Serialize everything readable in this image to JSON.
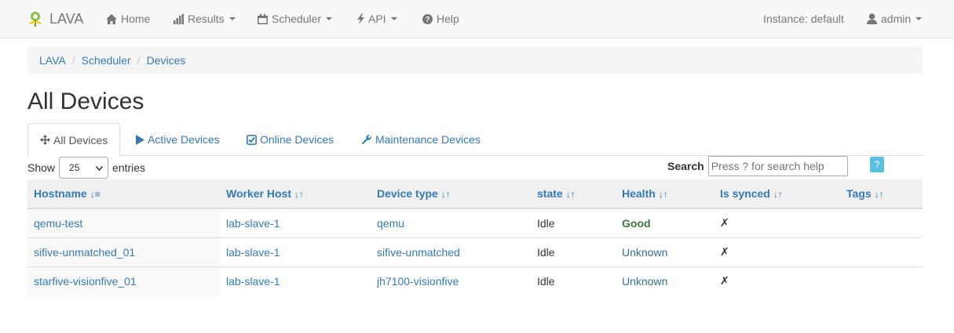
{
  "navbar": {
    "brand": "LAVA",
    "home": "Home",
    "results": "Results",
    "scheduler": "Scheduler",
    "api": "API",
    "help": "Help",
    "instance": "Instance: default",
    "user": "admin"
  },
  "breadcrumb": [
    "LAVA",
    "Scheduler",
    "Devices"
  ],
  "page_title": "All Devices",
  "tabs": [
    {
      "label": "All Devices",
      "icon": "move-icon"
    },
    {
      "label": "Active Devices",
      "icon": "play-icon"
    },
    {
      "label": "Online Devices",
      "icon": "check-square-icon"
    },
    {
      "label": "Maintenance Devices",
      "icon": "wrench-icon"
    }
  ],
  "controls": {
    "show_label": "Show",
    "entries_value": "25",
    "entries_label": "entries",
    "search_label": "Search",
    "search_placeholder": "Press ? for search help",
    "help_button": "?"
  },
  "table": {
    "columns": [
      "Hostname",
      "Worker Host",
      "Device type",
      "state",
      "Health",
      "Is synced",
      "Tags"
    ],
    "rows": [
      {
        "hostname": "qemu-test",
        "worker": "lab-slave-1",
        "device_type": "qemu",
        "state": "Idle",
        "health": "Good",
        "synced": "✗",
        "tags": ""
      },
      {
        "hostname": "sifive-unmatched_01",
        "worker": "lab-slave-1",
        "device_type": "sifive-unmatched",
        "state": "Idle",
        "health": "Unknown",
        "synced": "✗",
        "tags": ""
      },
      {
        "hostname": "starfive-visionfive_01",
        "worker": "lab-slave-1",
        "device_type": "jh7100-visionfive",
        "state": "Idle",
        "health": "Unknown",
        "synced": "✗",
        "tags": ""
      }
    ]
  },
  "colors": {
    "link": "#337ab7",
    "health_good": "#3c763d",
    "health_unknown": "#31708f",
    "help_button": "#5bc0de"
  }
}
